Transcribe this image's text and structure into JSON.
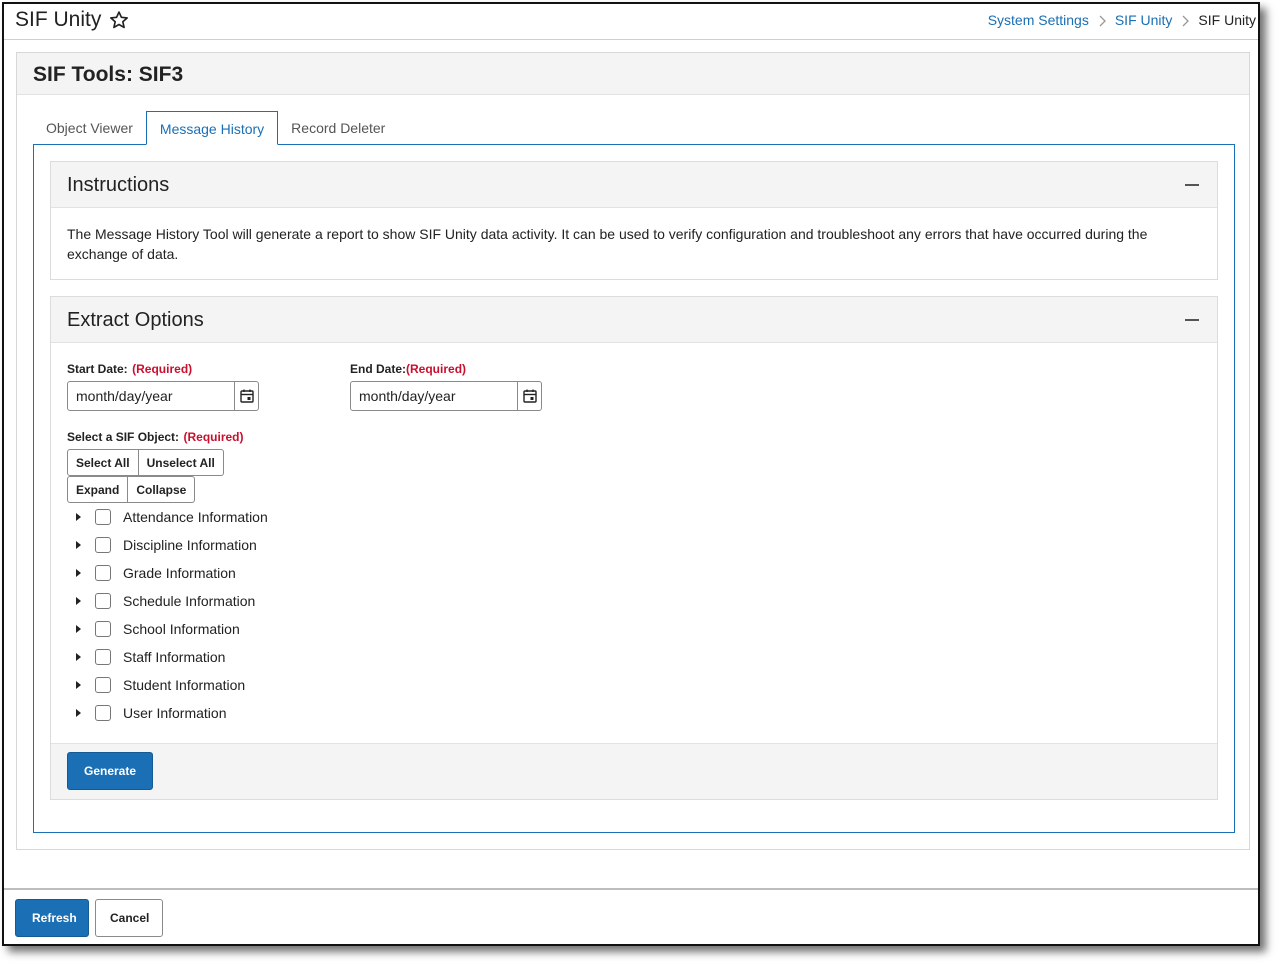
{
  "header": {
    "app_title": "SIF Unity",
    "star_icon": "star-outline-icon",
    "breadcrumb": [
      {
        "label": "System Settings",
        "link": true
      },
      {
        "label": "SIF Unity",
        "link": true
      },
      {
        "label": "SIF Unity",
        "link": false
      }
    ]
  },
  "panel": {
    "title": "SIF Tools: SIF3"
  },
  "tabs": [
    {
      "label": "Object Viewer",
      "active": false
    },
    {
      "label": "Message History",
      "active": true
    },
    {
      "label": "Record Deleter",
      "active": false
    }
  ],
  "instructions": {
    "title": "Instructions",
    "text": "The Message History Tool will generate a report to show SIF Unity data activity. It can be used to verify configuration and troubleshoot any errors that have occurred during the exchange of data."
  },
  "extract": {
    "title": "Extract Options",
    "start_date": {
      "label": "Start Date:",
      "required": "(Required)",
      "placeholder": "month/day/year",
      "value": ""
    },
    "end_date": {
      "label": "End Date:",
      "required": "(Required)",
      "placeholder": "month/day/year",
      "value": ""
    },
    "object_label": "Select a SIF Object:",
    "object_required": "(Required)",
    "select_all": "Select All",
    "unselect_all": "Unselect All",
    "expand": "Expand",
    "collapse": "Collapse",
    "objects": [
      {
        "label": "Attendance Information",
        "checked": false
      },
      {
        "label": "Discipline Information",
        "checked": false
      },
      {
        "label": "Grade Information",
        "checked": false
      },
      {
        "label": "Schedule Information",
        "checked": false
      },
      {
        "label": "School Information",
        "checked": false
      },
      {
        "label": "Staff Information",
        "checked": false
      },
      {
        "label": "Student Information",
        "checked": false
      },
      {
        "label": "User Information",
        "checked": false
      }
    ],
    "generate_label": "Generate"
  },
  "footer": {
    "refresh_label": "Refresh",
    "cancel_label": "Cancel"
  },
  "colors": {
    "accent": "#1a6fb5",
    "required": "#c8102e"
  }
}
